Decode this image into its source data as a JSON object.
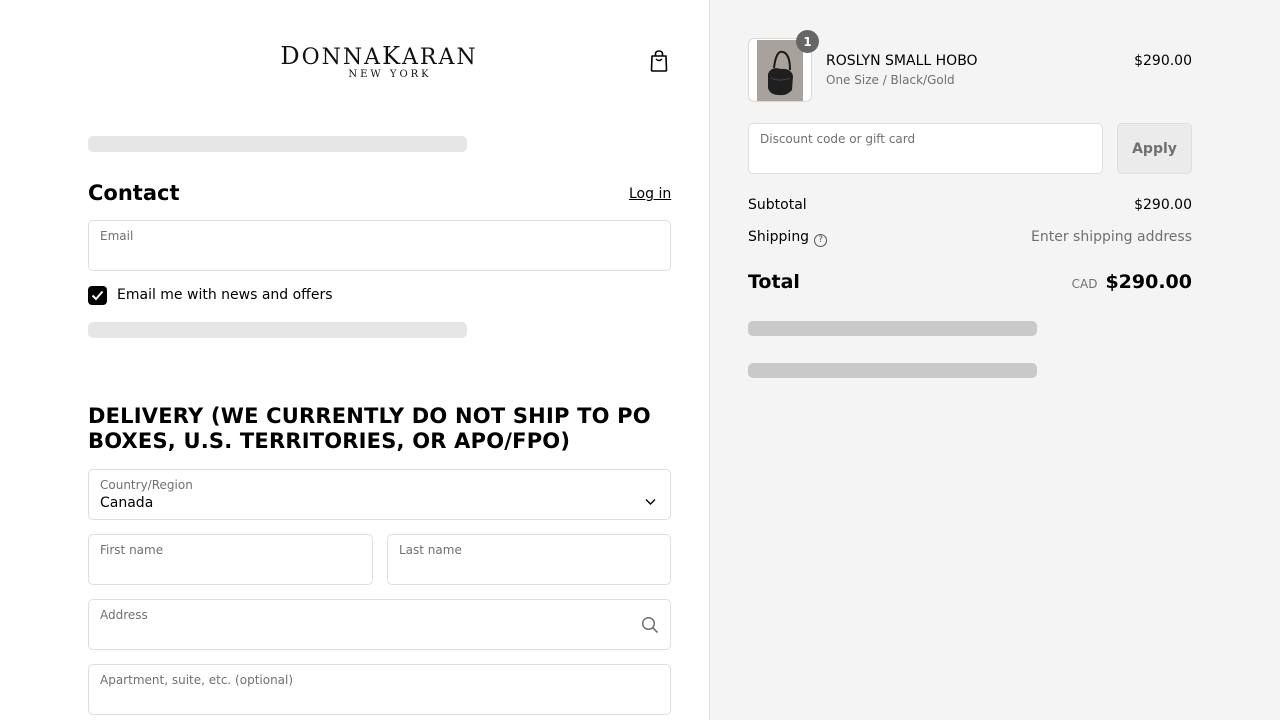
{
  "brand": {
    "logo_first_big": "D",
    "logo_first_rest": "ONNA",
    "logo_second_big": "K",
    "logo_second_rest": "ARAN",
    "logo_sub": "NEW YORK"
  },
  "contact": {
    "heading": "Contact",
    "login_link": "Log in",
    "email_label": "Email",
    "email_value": "",
    "newsletter_label": "Email me with news and offers",
    "newsletter_checked": true
  },
  "delivery": {
    "heading": "DELIVERY (WE CURRENTLY DO NOT SHIP TO PO BOXES, U.S. TERRITORIES, OR APO/FPO)",
    "country_label": "Country/Region",
    "country_value": "Canada",
    "first_name_label": "First name",
    "last_name_label": "Last name",
    "address_label": "Address",
    "apartment_label": "Apartment, suite, etc. (optional)"
  },
  "order": {
    "item": {
      "quantity": "1",
      "name": "ROSLYN SMALL HOBO",
      "variant": "One Size / Black/Gold",
      "price": "$290.00"
    },
    "discount_label": "Discount code or gift card",
    "apply_label": "Apply",
    "subtotal_label": "Subtotal",
    "subtotal_value": "$290.00",
    "shipping_label": "Shipping",
    "shipping_value": "Enter shipping address",
    "total_label": "Total",
    "currency": "CAD",
    "total_value": "$290.00"
  },
  "icons": {
    "bag": "shopping-bag-icon",
    "check": "checkmark-icon",
    "chevron": "chevron-down-icon",
    "search": "search-icon",
    "help": "help-circle-icon"
  },
  "colors": {
    "sidebar_bg": "#f4f4f4",
    "skeleton": "#e6e6e6",
    "badge": "#666666",
    "muted_text": "#707070"
  }
}
